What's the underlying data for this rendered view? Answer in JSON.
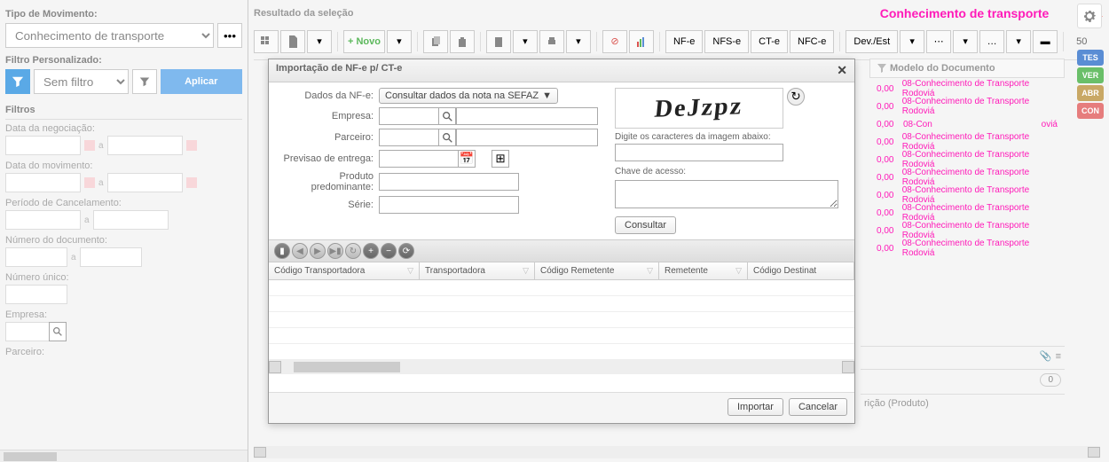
{
  "left": {
    "tipo_label": "Tipo de Movimento:",
    "tipo_value": "Conhecimento de transporte",
    "filtro_pers_label": "Filtro Personalizado:",
    "sem_filtro": "Sem filtro",
    "aplicar": "Aplicar",
    "filtros_header": "Filtros",
    "data_negociacao": "Data da negociação:",
    "data_movimento": "Data do movimento:",
    "periodo_cancel": "Período de Cancelamento:",
    "numero_doc": "Número do documento:",
    "numero_unico": "Número único:",
    "empresa": "Empresa:",
    "parceiro": "Parceiro:",
    "a": "a"
  },
  "main": {
    "result_label": "Resultado da seleção",
    "brand": "Conhecimento de transporte",
    "novo": "Novo",
    "nfe": "NF-e",
    "nfse": "NFS-e",
    "cte": "CT-e",
    "nfce": "NFC-e",
    "devest": "Dev./Est",
    "c50": "50",
    "col_modelo": "Modelo do Documento",
    "row_val": "0,00",
    "row_text": "08-Conhecimento de Transporte Rodoviá",
    "row_text2": "08-Con",
    "row_text3": "oviá",
    "descricao": "rição (Produto)",
    "badge0": "0"
  },
  "badges": {
    "tes": "TES",
    "ver": "VER",
    "abr": "ABR",
    "con": "CON"
  },
  "modal": {
    "title": "Importação de NF-e p/ CT-e",
    "dados_label": "Dados da NF-e:",
    "dados_value": "Consultar dados da nota na SEFAZ",
    "empresa": "Empresa:",
    "parceiro": "Parceiro:",
    "previsao": "Previsao de entrega:",
    "produto": "Produto predominante:",
    "serie": "Série:",
    "captcha_text": "DeJzpz",
    "captcha_label": "Digite os caracteres da imagem abaixo:",
    "chave_label": "Chave de acesso:",
    "consultar": "Consultar",
    "col1": "Código Transportadora",
    "col2": "Transportadora",
    "col3": "Código Remetente",
    "col4": "Remetente",
    "col5": "Código Destinat",
    "importar": "Importar",
    "cancelar": "Cancelar"
  }
}
